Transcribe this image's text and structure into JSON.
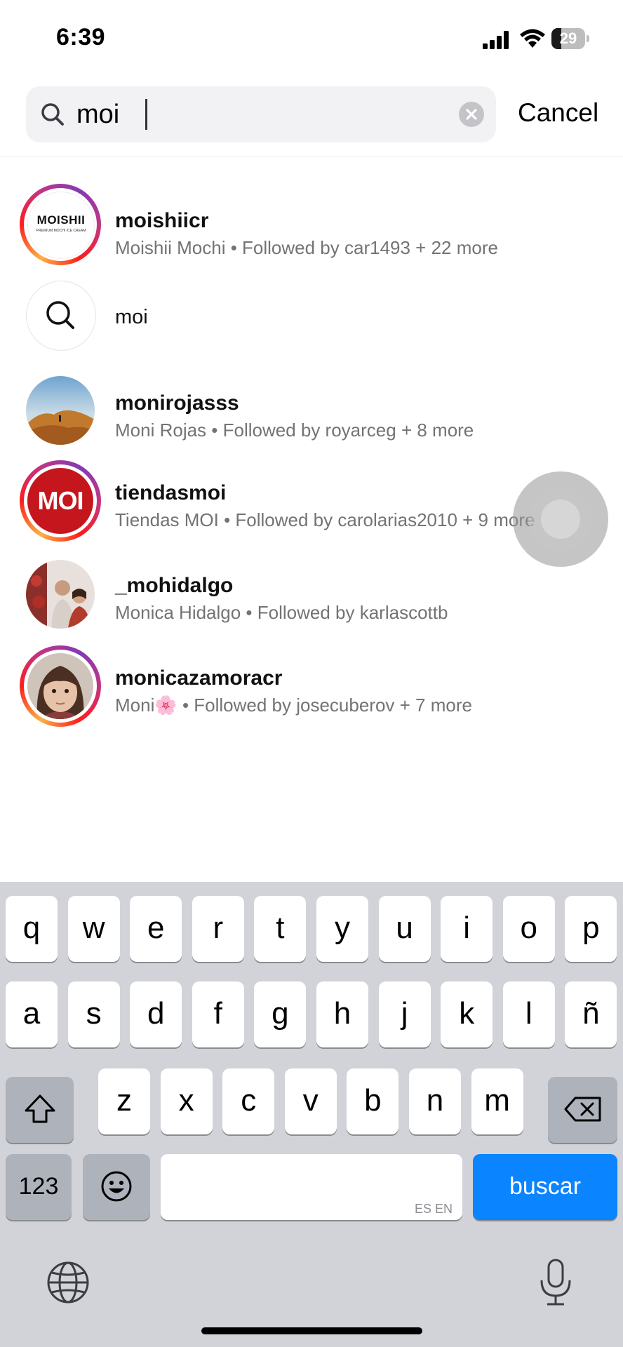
{
  "status_bar": {
    "time": "6:39",
    "battery": "29",
    "battery_level": 0.29
  },
  "search": {
    "query": "moi",
    "cancel_label": "Cancel"
  },
  "results": [
    {
      "username": "moishiicr",
      "subtitle": "Moishii Mochi • Followed by car1493 + 22 more",
      "avatar_text": "MOISHII",
      "avatar_tagline": "PREMIUM MOCHI ICE CREAM",
      "story_ring": true
    },
    {
      "username": "moi",
      "type": "search-suggestion"
    },
    {
      "username": "monirojasss",
      "subtitle": "Moni Rojas • Followed by royarceg + 8 more",
      "story_ring": false
    },
    {
      "username": "tiendasmoi",
      "subtitle": "Tiendas MOI • Followed by carolarias2010 + 9 more",
      "avatar_text": "MOI",
      "story_ring": true
    },
    {
      "username": "_mohidalgo",
      "subtitle": "Monica Hidalgo • Followed by karlascottb",
      "story_ring": false
    },
    {
      "username": "monicazamoracr",
      "subtitle": "Moni🌸 • Followed by josecuberov + 7 more",
      "story_ring": true
    }
  ],
  "keyboard": {
    "row1": [
      "q",
      "w",
      "e",
      "r",
      "t",
      "y",
      "u",
      "i",
      "o",
      "p"
    ],
    "row2": [
      "a",
      "s",
      "d",
      "f",
      "g",
      "h",
      "j",
      "k",
      "l",
      "ñ"
    ],
    "row3": [
      "z",
      "x",
      "c",
      "v",
      "b",
      "n",
      "m"
    ],
    "numbers_label": "123",
    "space_lang": "ES EN",
    "action_label": "buscar"
  },
  "colors": {
    "accent": "#0a84ff",
    "secondary_text": "#737373",
    "keyboard_bg": "#d1d3d9"
  },
  "icons": [
    "search-icon",
    "clear-icon",
    "shift-icon",
    "backspace-icon",
    "emoji-icon",
    "globe-icon",
    "microphone-icon"
  ]
}
